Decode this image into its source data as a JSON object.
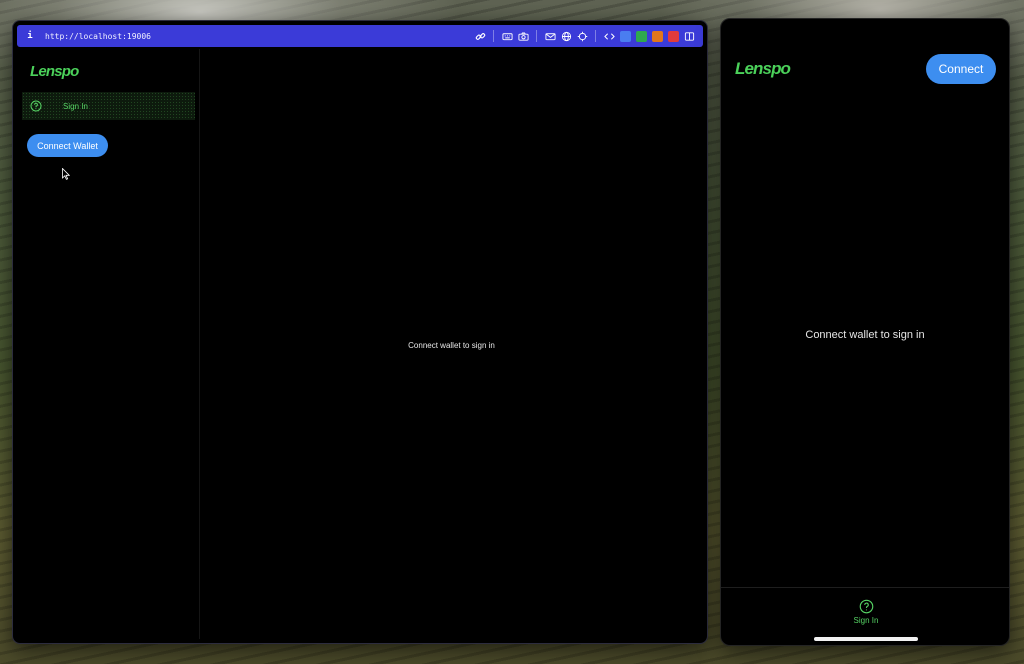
{
  "browser": {
    "url": "http://localhost:19006",
    "info_glyph": "i",
    "toolbar_icons": [
      "link-icon",
      "keyboard-icon",
      "camera-icon",
      "mail-icon",
      "globe-icon",
      "crosshair-icon",
      "code-icon"
    ],
    "extensions": [
      {
        "name": "shield-extension-icon",
        "color": "#4a7df0"
      },
      {
        "name": "green-extension-icon",
        "color": "#2fa84f"
      },
      {
        "name": "fox-extension-icon",
        "color": "#e2761b"
      },
      {
        "name": "red-extension-icon",
        "color": "#e23b3b"
      }
    ]
  },
  "app": {
    "brand": "Lenspo",
    "nav_items": [
      {
        "label": "Sign In",
        "icon": "question-circle-icon"
      }
    ],
    "connect_wallet_label": "Connect Wallet",
    "main_message": "Connect wallet to sign in"
  },
  "mobile": {
    "brand": "Lenspo",
    "connect_label": "Connect",
    "message": "Connect wallet to sign in",
    "tab": {
      "label": "Sign In",
      "icon": "question-circle-icon"
    }
  },
  "colors": {
    "accent_blue": "#3d8ef0",
    "brand_green": "#4bd15a",
    "browser_bar": "#3b3bd8"
  }
}
